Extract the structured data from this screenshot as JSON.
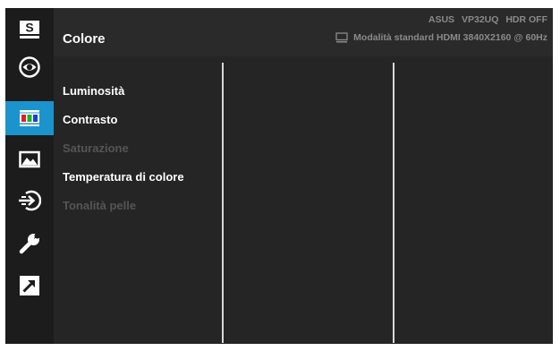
{
  "header": {
    "title": "Colore",
    "brand": "ASUS",
    "model": "VP32UQ",
    "hdr": "HDR OFF",
    "mode_info": "Modalità standard HDMI 3840X2160 @ 60Hz"
  },
  "sidebar": {
    "items": [
      {
        "icon": "splendid-icon",
        "label": "S"
      },
      {
        "icon": "eye-icon"
      },
      {
        "icon": "color-bars-icon",
        "active": true
      },
      {
        "icon": "image-icon"
      },
      {
        "icon": "input-select-icon"
      },
      {
        "icon": "wrench-icon"
      },
      {
        "icon": "shortcut-icon"
      }
    ]
  },
  "menu": {
    "items": [
      {
        "label": "Luminosità",
        "enabled": true
      },
      {
        "label": "Contrasto",
        "enabled": true
      },
      {
        "label": "Saturazione",
        "enabled": false
      },
      {
        "label": "Temperatura di colore",
        "enabled": true
      },
      {
        "label": "Tonalità pelle",
        "enabled": false
      }
    ]
  },
  "colors": {
    "accent": "#1b94cd",
    "background": "#252525",
    "text": "#ffffff",
    "text_disabled": "#555555",
    "status_text": "#8a8a8a"
  }
}
